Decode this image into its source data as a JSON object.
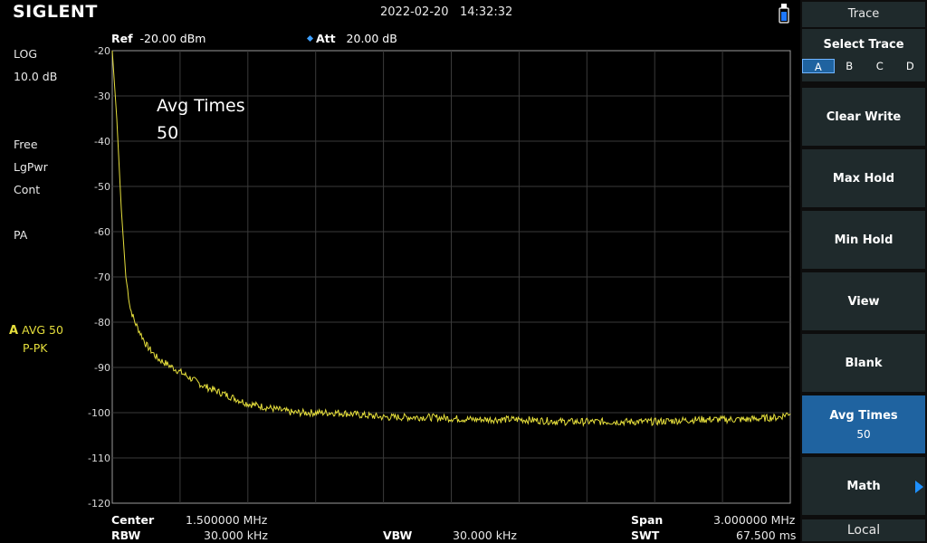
{
  "header": {
    "logo": "SIGLENT",
    "datetime": "2022-02-20   14:32:32"
  },
  "top_params": {
    "ref_label": "Ref",
    "ref_value": "-20.00 dBm",
    "att_label": "Att",
    "att_value": "20.00 dB"
  },
  "left_info": {
    "scale_type": "LOG",
    "scale_div": "10.0 dB",
    "trig": "Free",
    "detector": "LgPwr",
    "sweep": "Cont",
    "preamp": "PA",
    "trace_letter": "A",
    "trace_mode": "AVG 50",
    "trace_detector": "P-PK"
  },
  "overlay": {
    "title": "Avg Times",
    "value": "50"
  },
  "y_axis": {
    "ticks": [
      "-20",
      "-30",
      "-40",
      "-50",
      "-60",
      "-70",
      "-80",
      "-90",
      "-100",
      "-110",
      "-120"
    ]
  },
  "bottom": {
    "center_label": "Center",
    "center_value": "1.500000 MHz",
    "rbw_label": "RBW",
    "rbw_value": "30.000 kHz",
    "vbw_label": "VBW",
    "vbw_value": "30.000 kHz",
    "span_label": "Span",
    "span_value": "3.000000 MHz",
    "swt_label": "SWT",
    "swt_value": "67.500 ms"
  },
  "panel": {
    "title": "Trace",
    "select_trace": "Select Trace",
    "tabs": [
      "A",
      "B",
      "C",
      "D"
    ],
    "active_tab": "A",
    "clear_write": "Clear Write",
    "max_hold": "Max Hold",
    "min_hold": "Min Hold",
    "view": "View",
    "blank": "Blank",
    "avg_times": "Avg Times",
    "avg_times_value": "50",
    "math": "Math",
    "local": "Local"
  },
  "colors": {
    "trace": "#e6df3c",
    "accent": "#1f63a0",
    "softkey_bg": "#1f2a2c"
  },
  "chart_data": {
    "type": "line",
    "xlabel": "",
    "ylabel": "",
    "xlim": [
      0,
      3.0
    ],
    "ylim": [
      -120,
      -20
    ],
    "grid": true,
    "series": [
      {
        "x": [
          0,
          0.02,
          0.04,
          0.06,
          0.08,
          0.1,
          0.15,
          0.2,
          0.3,
          0.4,
          0.5,
          0.6,
          0.7,
          0.8,
          0.9,
          1.0,
          1.2,
          1.4,
          1.6,
          1.8,
          2.0,
          2.2,
          2.4,
          2.6,
          2.8,
          2.95,
          3.0
        ],
        "y": [
          -20,
          -35,
          -55,
          -70,
          -77,
          -80,
          -85,
          -88,
          -91,
          -94,
          -96,
          -98,
          -99,
          -100,
          -100,
          -100,
          -101,
          -101,
          -101.5,
          -101.5,
          -102,
          -102,
          -102,
          -101.5,
          -101.5,
          -101,
          -100
        ]
      }
    ]
  }
}
